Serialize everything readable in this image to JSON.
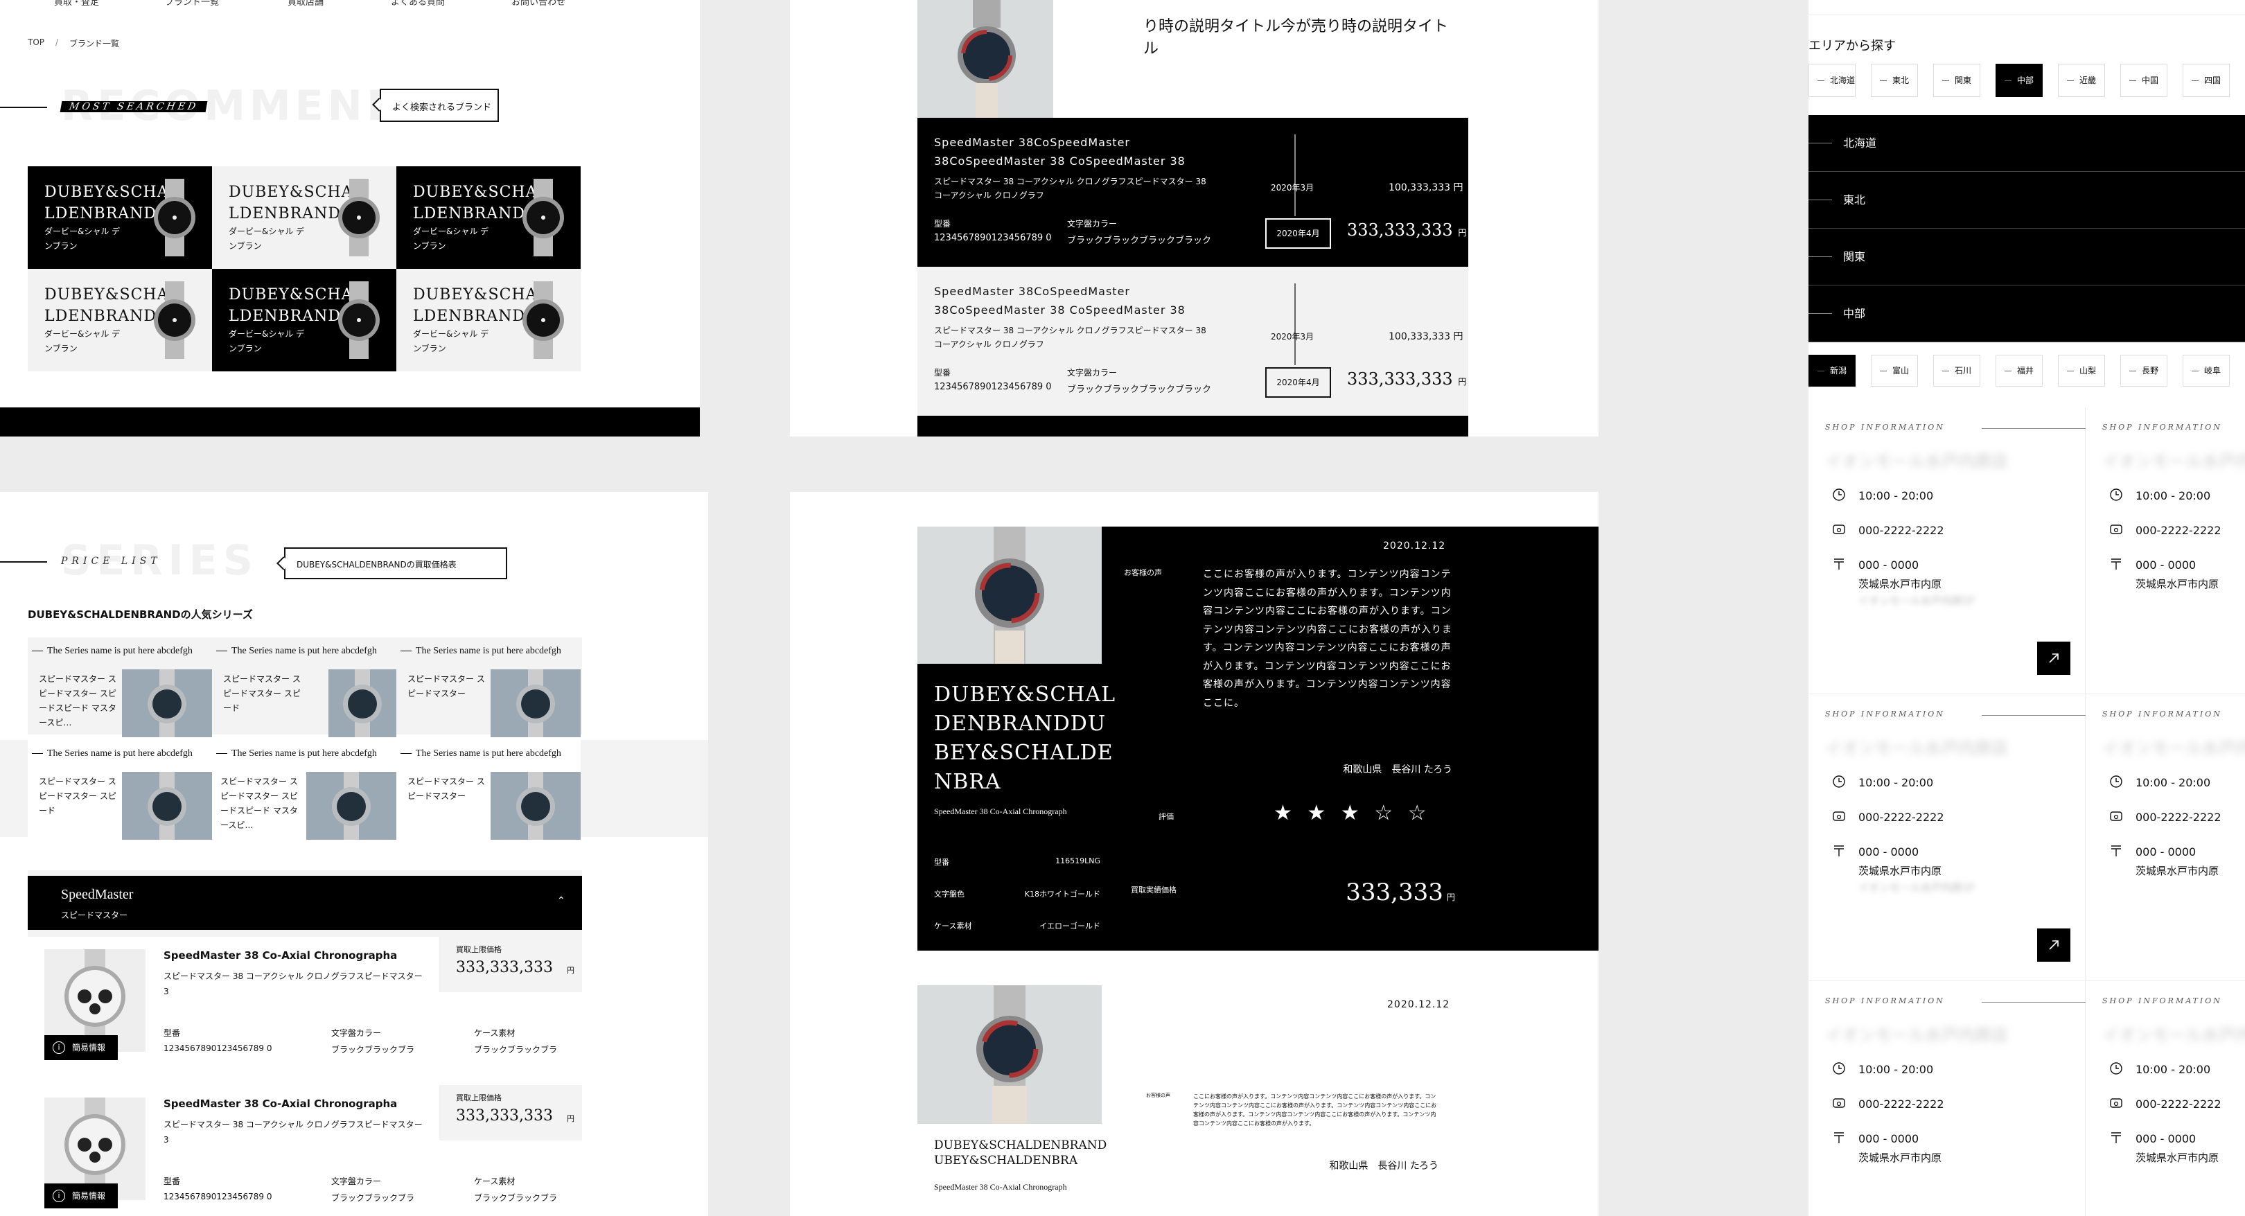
{
  "panel1": {
    "nav": [
      "買取・査定",
      "ブランド一覧",
      "買取店舗",
      "よくある質問",
      "お問い合わせ"
    ],
    "breadcrumb": [
      "TOP",
      "/",
      "ブランド一覧"
    ],
    "bg_word": "RECOMMEND",
    "sub_word": "MOST SEARCHED",
    "bubble": "よく検索されるブランド",
    "brands": [
      {
        "name": "DUBEY&SCHA LDENBRAND",
        "kana": "ダービー&シャル デンブラン"
      },
      {
        "name": "DUBEY&SCHA LDENBRAND",
        "kana": "ダービー&シャル デンブラン"
      },
      {
        "name": "DUBEY&SCHA LDENBRAND",
        "kana": "ダービー&シャル デンブラン"
      },
      {
        "name": "DUBEY&SCHA LDENBRAND",
        "kana": "ダービー&シャル デンブラン"
      },
      {
        "name": "DUBEY&SCHA LDENBRAND",
        "kana": "ダービー&シャル デンブラン"
      },
      {
        "name": "DUBEY&SCHA LDENBRAND",
        "kana": "ダービー&シャル デンブラン"
      }
    ]
  },
  "panel2": {
    "header_text": "り時の説明タイトル今が売り時の説明タイトル",
    "rows": [
      {
        "title": "SpeedMaster 38CoSpeedMaster 38CoSpeedMaster 38 CoSpeedMaster 38",
        "desc": "スピードマスター 38 コーアクシャル クロノグラフスピードマスター 38 コーアクシャル クロノグラフ",
        "model_label": "型番",
        "model": "1234567890123456789 0",
        "dial_label": "文字盤カラー",
        "dial": "ブラックブラックブラックブラック",
        "month1": "2020年3月",
        "price1": "100,333,333 円",
        "month2": "2020年4月",
        "price2": "333,333,333",
        "yen": "円"
      },
      {
        "title": "SpeedMaster 38CoSpeedMaster 38CoSpeedMaster 38 CoSpeedMaster 38",
        "desc": "スピードマスター 38 コーアクシャル クロノグラフスピードマスター 38 コーアクシャル クロノグラフ",
        "model_label": "型番",
        "model": "1234567890123456789 0",
        "dial_label": "文字盤カラー",
        "dial": "ブラックブラックブラックブラック",
        "month1": "2020年3月",
        "price1": "100,333,333 円",
        "month2": "2020年4月",
        "price2": "333,333,333",
        "yen": "円"
      }
    ]
  },
  "panel3": {
    "bg_word": "SERIES",
    "sub_word": "PRICE LIST",
    "bubble": "DUBEY&SCHALDENBRANDの買取価格表",
    "popular_title": "DUBEY&SCHALDENBRANDの人気シリーズ",
    "series": [
      {
        "name": "The Series name is put here abcdefgh",
        "desc": "スピードマスター スピードマスター スピードスピード マスタースピ…"
      },
      {
        "name": "The Series name is put here abcdefgh",
        "desc": "スピードマスター スピードマスター スピード"
      },
      {
        "name": "The Series name is put here abcdefgh",
        "desc": "スピードマスター スピードマスター"
      },
      {
        "name": "The Series name is put here abcdefgh",
        "desc": "スピードマスター スピードマスター スピード"
      },
      {
        "name": "The Series name is put here abcdefgh",
        "desc": "スピードマスター スピードマスター スピードスピード マスタースピ…"
      },
      {
        "name": "The Series name is put here abcdefgh",
        "desc": "スピードマスター スピードマスター"
      }
    ],
    "accordion_title": "SpeedMaster",
    "accordion_sub": "スピードマスター",
    "products": [
      {
        "title": "SpeedMaster 38 Co-Axial Chronographa",
        "desc": "スピードマスター 38 コーアクシャル クロノグラフスピードマスター 3",
        "price_label": "買取上限価格",
        "price": "333,333,333",
        "yen": "円",
        "model_label": "型番",
        "model": "1234567890123456789 0",
        "dial_label": "文字盤カラー",
        "dial": "ブラックブラックブラ",
        "case_label": "ケース素材",
        "case": "ブラックブラックブラ",
        "info_label": "簡易情報"
      },
      {
        "title": "SpeedMaster 38 Co-Axial Chronographa",
        "desc": "スピードマスター 38 コーアクシャル クロノグラフスピードマスター 3",
        "price_label": "買取上限価格",
        "price": "333,333,333",
        "yen": "円",
        "model_label": "型番",
        "model": "1234567890123456789 0",
        "dial_label": "文字盤カラー",
        "dial": "ブラックブラックブラ",
        "case_label": "ケース素材",
        "case": "ブラックブラックブラ",
        "info_label": "簡易情報"
      }
    ]
  },
  "panel4": {
    "review1": {
      "date": "2020.12.12",
      "voice_label": "お客様の声",
      "voice": "ここにお客様の声が入ります。コンテンツ内容コンテンツ内容ここにお客様の声が入ります。コンテンツ内容コンテンツ内容ここにお客様の声が入ります。コンテンツ内容コンテンツ内容ここにお客様の声が入ります。コンテンツ内容コンテンツ内容ここにお客様の声が入ります。コンテンツ内容コンテンツ内容ここにお客様の声が入ります。コンテンツ内容コンテンツ内容ここに。",
      "author": "和歌山県　長谷川 たろう",
      "brand": "DUBEY&SCHAL DENBRANDDU BEY&SCHALDE NBRA",
      "model_name": "SpeedMaster 38 Co-Axial Chronograph",
      "rating_label": "評価",
      "stars": "★ ★ ★ ☆ ☆",
      "rating": 3,
      "specs": [
        {
          "label": "型番",
          "value": "116519LNG"
        },
        {
          "label": "文字盤色",
          "value": "K18ホワイトゴールド"
        },
        {
          "label": "ケース素材",
          "value": "イエローゴールド"
        }
      ],
      "price_label": "買取実績価格",
      "price": "333,333",
      "yen": "円"
    },
    "review2": {
      "date": "2020.12.12",
      "voice_label": "お客様の声",
      "voice": "ここにお客様の声が入ります。コンテンツ内容コンテンツ内容ここにお客様の声が入ります。コンテンツ内容コンテンツ内容ここにお客様の声が入ります。コンテンツ内容コンテンツ内容ここにお客様の声が入ります。コンテンツ内容コンテンツ内容ここにお客様の声が入ります。コンテンツ内容コンテンツ内容ここにお客様の声が入ります。",
      "author": "和歌山県　長谷川 たろう",
      "brand": "DUBEY&SCHALDENBRAND UBEY&SCHALDENBRA",
      "model_name": "SpeedMaster 38 Co-Axial Chronograph"
    }
  },
  "panel5": {
    "area_title": "エリアから探す",
    "areas": [
      "北海道",
      "東北",
      "関東",
      "中部",
      "近畿",
      "中国",
      "四国"
    ],
    "selected_area": "中部",
    "regions": [
      "北海道",
      "東北",
      "関東",
      "中部"
    ],
    "prefs": [
      "新潟",
      "富山",
      "石川",
      "福井",
      "山梨",
      "長野",
      "岐阜"
    ],
    "selected_pref": "新潟",
    "shop_header": "SHOP INFORMATION",
    "shop_name": "イオンモール水戸内原店",
    "hours": "10:00 - 20:00",
    "phone": "000-2222-2222",
    "postal": "000 - 0000",
    "address": "茨城県水戸市内原",
    "address2": "イオンモール水戸内原1F"
  }
}
